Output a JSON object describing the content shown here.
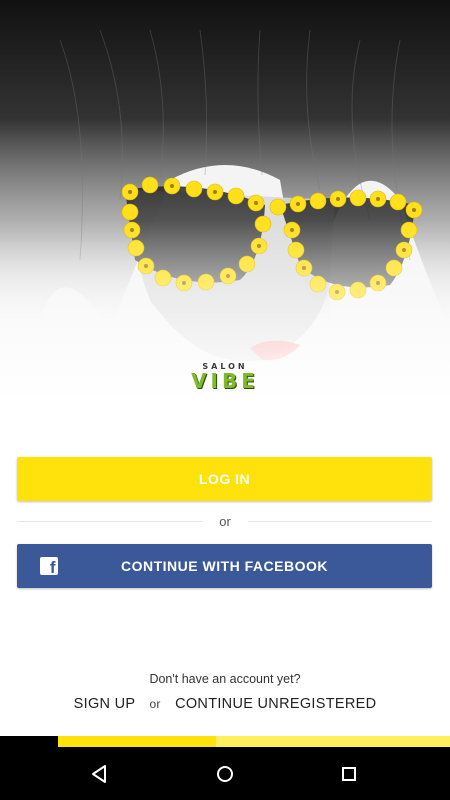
{
  "brand": {
    "small": "SALON",
    "main": "VIBE",
    "colors": {
      "accent": "#7dbb2a",
      "yellow": "#ffe20b",
      "facebook": "#3b5998"
    }
  },
  "hero": {
    "image": "woman-with-yellow-flower-sunglasses"
  },
  "buttons": {
    "login": "LOG IN",
    "facebook": "CONTINUE WITH FACEBOOK"
  },
  "divider_text": "or",
  "footer": {
    "prompt": "Don't have an account yet?",
    "signup": "SIGN UP",
    "separator": "or",
    "unregistered": "CONTINUE UNREGISTERED"
  },
  "navbar": {
    "icons": [
      "back-icon",
      "home-icon",
      "recents-icon"
    ]
  }
}
